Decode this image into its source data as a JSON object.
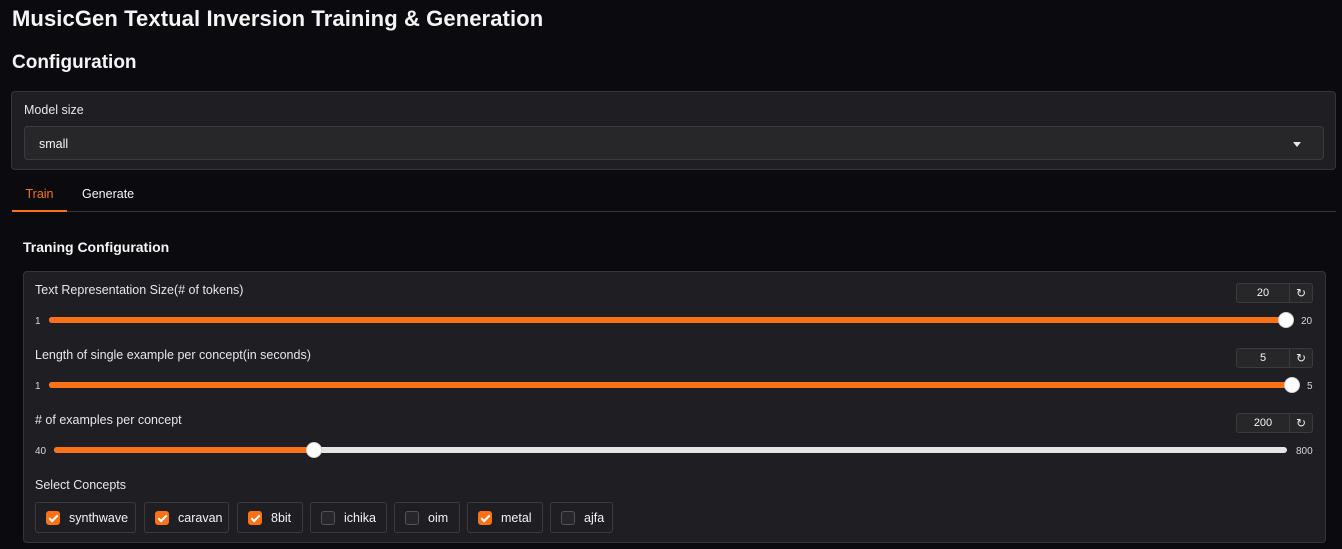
{
  "page_title": "MusicGen Textual Inversion Training & Generation",
  "config_heading": "Configuration",
  "model": {
    "label": "Model size",
    "value": "small"
  },
  "tabs": [
    {
      "label": "Train",
      "active": true
    },
    {
      "label": "Generate",
      "active": false
    }
  ],
  "training": {
    "title": "Traning Configuration",
    "sliders": [
      {
        "label": "Text Representation Size(# of tokens)",
        "value": 20,
        "min": 1,
        "max": 20
      },
      {
        "label": "Length of single example per concept(in seconds)",
        "value": 5,
        "min": 1,
        "max": 5
      },
      {
        "label": "# of examples per concept",
        "value": 200,
        "min": 40,
        "max": 800
      }
    ],
    "reset_glyph": "↻",
    "concepts_label": "Select Concepts",
    "concepts": [
      {
        "label": "synthwave",
        "checked": true
      },
      {
        "label": "caravan",
        "checked": true
      },
      {
        "label": "8bit",
        "checked": true
      },
      {
        "label": "ichika",
        "checked": false
      },
      {
        "label": "oim",
        "checked": false
      },
      {
        "label": "metal",
        "checked": true
      },
      {
        "label": "ajfa",
        "checked": false
      }
    ]
  },
  "colors": {
    "accent": "#f97316",
    "background": "#0b0b0f",
    "panel": "#1f1f23"
  }
}
